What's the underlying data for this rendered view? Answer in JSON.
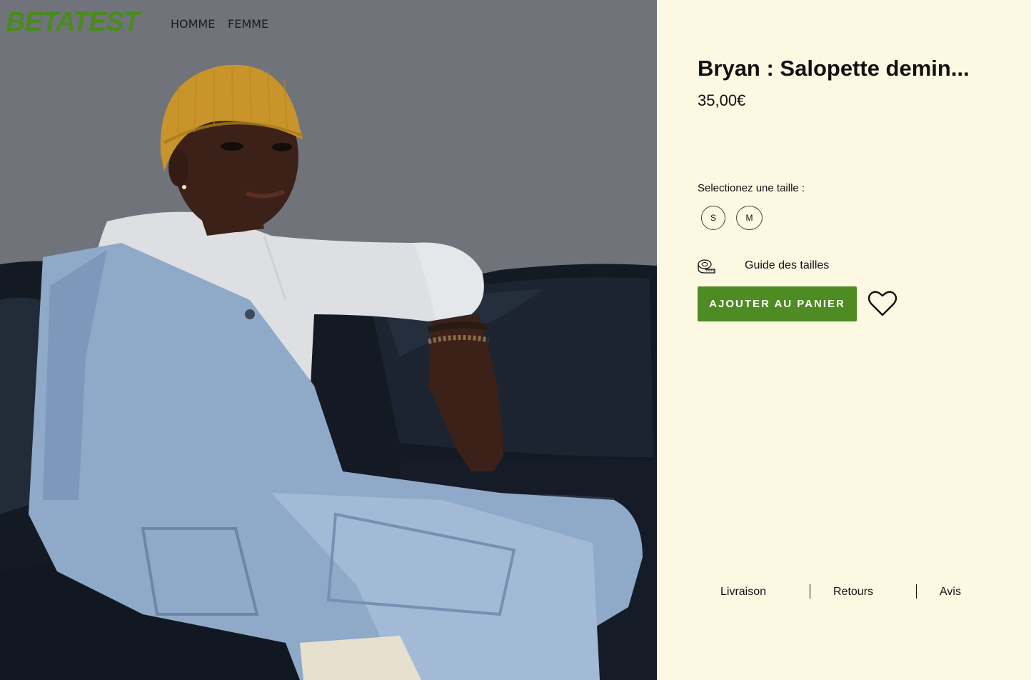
{
  "brand": {
    "logo": "BETATEST",
    "accent_color": "#4e8b22"
  },
  "nav": {
    "items": [
      {
        "label": "HOMME"
      },
      {
        "label": "FEMME"
      }
    ]
  },
  "product": {
    "title": "Bryan : Salopette demin...",
    "price": "35,00€",
    "size_prompt": "Selectionez une taille :",
    "sizes": [
      {
        "label": "S"
      },
      {
        "label": "M"
      }
    ],
    "size_guide": {
      "label": "Guide des tailles",
      "icon": "measuring-tape-icon"
    },
    "add_to_cart": "AJOUTER AU PANIER",
    "wishlist_icon": "heart-icon"
  },
  "footer": {
    "links": [
      {
        "label": "Livraison"
      },
      {
        "label": "Retours"
      },
      {
        "label": "Avis"
      }
    ]
  }
}
